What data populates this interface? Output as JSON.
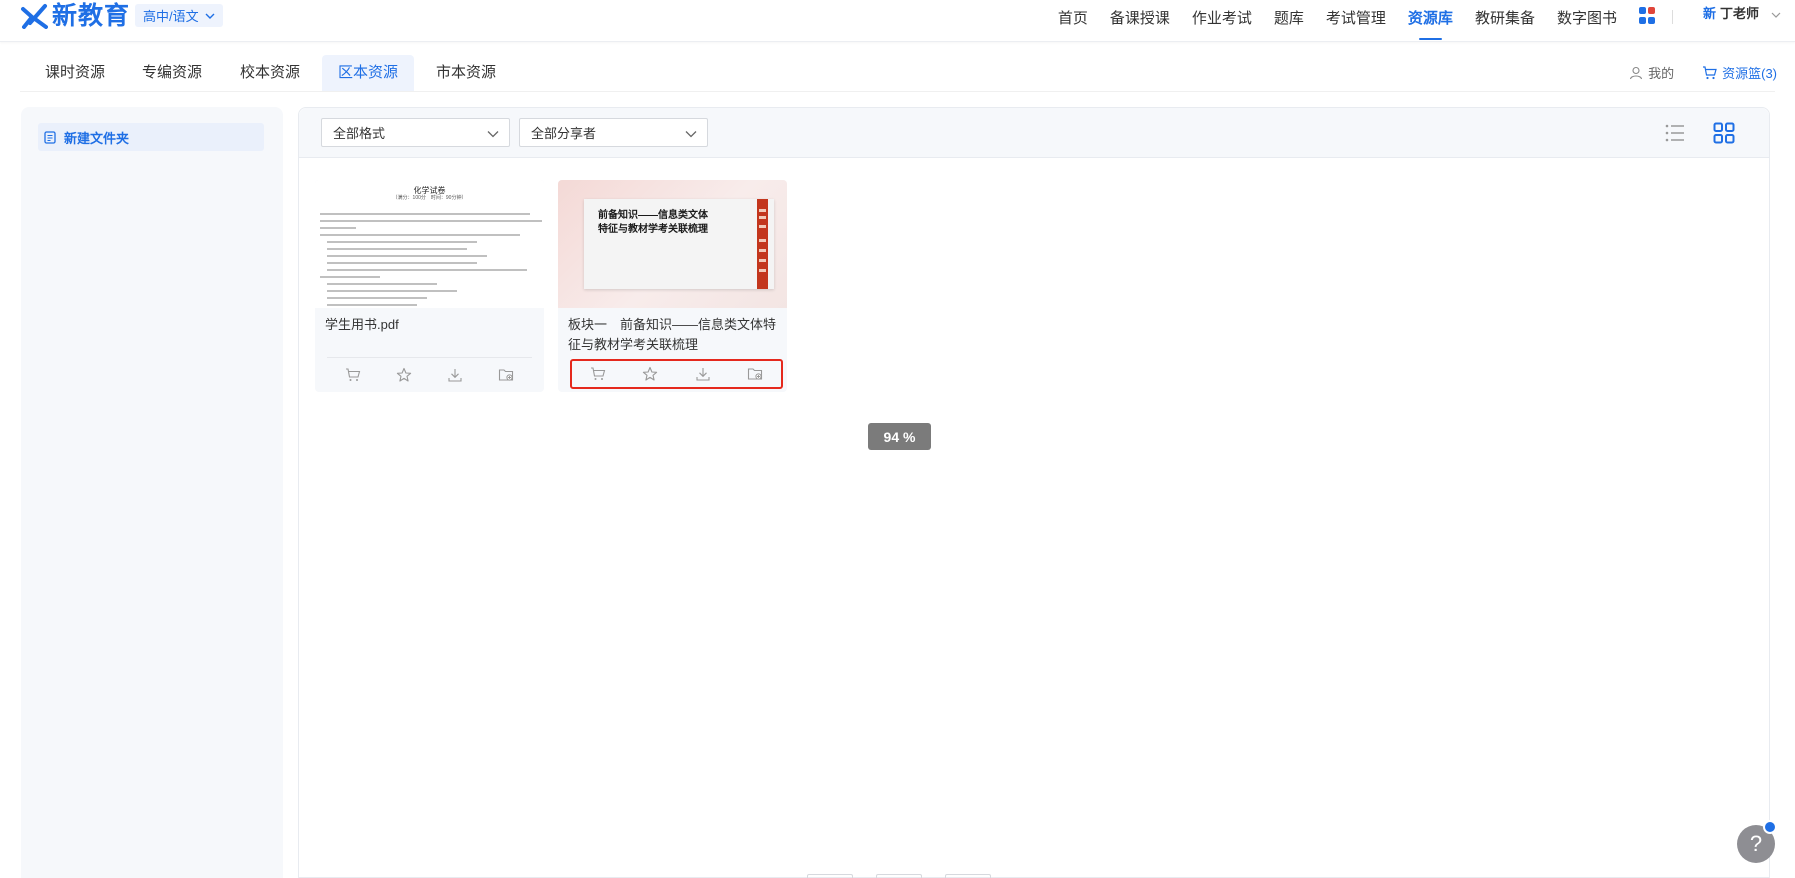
{
  "header": {
    "logo_text": "新教育",
    "grade_subject": "高中/语文",
    "nav": [
      "首页",
      "备课授课",
      "作业考试",
      "题库",
      "考试管理",
      "资源库",
      "教研集备",
      "数字图书"
    ],
    "nav_active_index": 5,
    "user_logo": "新",
    "user_name": "丁老师"
  },
  "tabs": [
    "课时资源",
    "专编资源",
    "校本资源",
    "区本资源",
    "市本资源"
  ],
  "tabs_active_index": 3,
  "tabs_right": {
    "mine": "我的",
    "basket": "资源篮(3)"
  },
  "sidebar": {
    "new_folder": "新建文件夹"
  },
  "filters": {
    "format": "全部格式",
    "sharer": "全部分享者"
  },
  "cards": [
    {
      "title": "学生用书.pdf",
      "thumb": {
        "heading": "化学试卷",
        "subheading": "（满分：100分　时间：90分钟）"
      }
    },
    {
      "title": "板块一　前备知识——信息类文体特征与教材学考关联梳理",
      "thumb": {
        "heading_line1": "前备知识——信息类文体",
        "heading_line2": "特征与教材学考关联梳理"
      }
    }
  ],
  "zoom_label": "94 %",
  "help_label": "?",
  "colors": {
    "accent": "#1f6fe5",
    "highlight": "#e5291d",
    "ppt_bar": "#c3361d"
  }
}
